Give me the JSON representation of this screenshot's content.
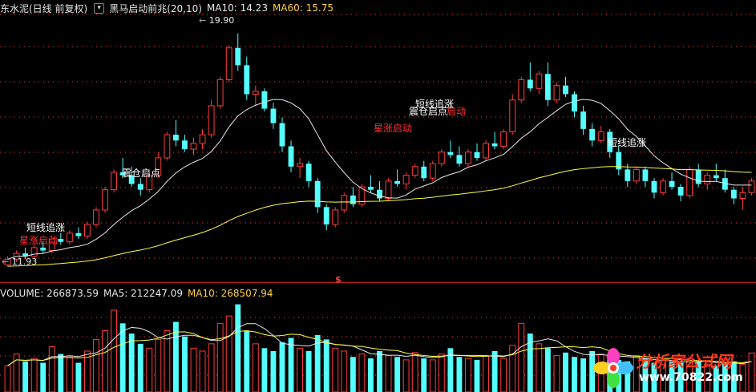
{
  "price_header": {
    "stock_title": "东水泥(日线 前复权)",
    "indicator_name": "黑马启动前兆(20,10)",
    "ma10_label": "MA10: 14.23",
    "ma60_label": "MA60: 15.75"
  },
  "volume_header": {
    "volume_label": "VOLUME: 266873.59",
    "ma5_label": "MA5: 212247.09",
    "ma10_label": "MA10: 268507.94"
  },
  "price_markers": {
    "high_label": "19.90",
    "low_label": "11.93"
  },
  "annotations": [
    {
      "text": "短线追涨",
      "color": "#ffffff"
    },
    {
      "text": "星涨启动",
      "color": "#ff3030"
    },
    {
      "text": "震仓启点",
      "color": "#ffffff"
    },
    {
      "text": "星涨启动",
      "color": "#ff3030"
    },
    {
      "text": "短线追涨",
      "color": "#ffffff"
    },
    {
      "text": "震仓启点",
      "color": "#ffffff"
    },
    {
      "text": "启动",
      "color": "#ff3030"
    },
    {
      "text": "短线追涨",
      "color": "#ffffff"
    }
  ],
  "separator_marker": "$",
  "watermark": {
    "title": "分析家公式网",
    "url": "www.70822.com"
  },
  "colors": {
    "up": "#ff3c3c",
    "down": "#54ffff",
    "ma10_line": "#e8e8e8",
    "ma60_line": "#ffff40",
    "dotted_guides": "#ff3c3c"
  },
  "chart_data": [
    {
      "type": "candlestick",
      "title": "东水泥(日线 前复权)",
      "candles": [
        [
          11.9,
          12.2,
          11.85,
          12.1
        ],
        [
          12.1,
          12.4,
          12.0,
          12.3
        ],
        [
          12.3,
          12.5,
          12.1,
          12.2
        ],
        [
          12.2,
          12.6,
          12.1,
          12.5
        ],
        [
          12.5,
          12.7,
          12.3,
          12.4
        ],
        [
          12.4,
          12.9,
          12.3,
          12.8
        ],
        [
          12.8,
          13.0,
          12.6,
          12.7
        ],
        [
          12.7,
          13.1,
          12.6,
          13.0
        ],
        [
          13.0,
          13.2,
          12.8,
          12.9
        ],
        [
          12.9,
          13.4,
          12.8,
          13.3
        ],
        [
          13.3,
          13.9,
          13.2,
          13.8
        ],
        [
          13.8,
          14.6,
          13.7,
          14.5
        ],
        [
          14.5,
          15.2,
          14.4,
          15.1
        ],
        [
          15.1,
          15.6,
          14.9,
          15.0
        ],
        [
          15.0,
          15.3,
          14.6,
          14.7
        ],
        [
          14.7,
          14.9,
          14.3,
          14.5
        ],
        [
          14.5,
          15.1,
          14.4,
          15.0
        ],
        [
          15.0,
          15.8,
          14.9,
          15.6
        ],
        [
          15.6,
          16.5,
          15.5,
          16.4
        ],
        [
          16.4,
          16.9,
          16.0,
          16.2
        ],
        [
          16.2,
          16.4,
          15.8,
          15.9
        ],
        [
          15.9,
          16.3,
          15.7,
          16.1
        ],
        [
          16.1,
          16.6,
          15.9,
          16.4
        ],
        [
          16.4,
          17.6,
          16.3,
          17.4
        ],
        [
          17.4,
          18.4,
          17.3,
          18.3
        ],
        [
          18.3,
          19.5,
          18.2,
          19.4
        ],
        [
          19.4,
          19.9,
          18.6,
          18.8
        ],
        [
          18.8,
          19.1,
          17.6,
          17.8
        ],
        [
          17.8,
          18.1,
          17.4,
          17.9
        ],
        [
          17.9,
          18.0,
          17.2,
          17.3
        ],
        [
          17.3,
          17.5,
          16.6,
          16.8
        ],
        [
          16.8,
          17.0,
          15.8,
          16.0
        ],
        [
          16.0,
          16.2,
          15.1,
          15.3
        ],
        [
          15.3,
          15.6,
          14.9,
          15.4
        ],
        [
          15.4,
          15.5,
          14.6,
          14.8
        ],
        [
          14.8,
          14.9,
          13.7,
          13.9
        ],
        [
          13.9,
          14.0,
          13.1,
          13.3
        ],
        [
          13.3,
          13.9,
          13.2,
          13.8
        ],
        [
          13.8,
          14.4,
          13.7,
          14.3
        ],
        [
          14.3,
          14.6,
          13.9,
          14.0
        ],
        [
          14.0,
          14.7,
          13.9,
          14.6
        ],
        [
          14.6,
          15.0,
          14.4,
          14.5
        ],
        [
          14.5,
          14.8,
          14.1,
          14.2
        ],
        [
          14.2,
          14.9,
          14.1,
          14.8
        ],
        [
          14.8,
          15.2,
          14.6,
          14.7
        ],
        [
          14.7,
          15.1,
          14.5,
          15.0
        ],
        [
          15.0,
          15.4,
          14.9,
          15.3
        ],
        [
          15.3,
          15.5,
          14.8,
          14.9
        ],
        [
          14.9,
          15.5,
          14.8,
          15.4
        ],
        [
          15.4,
          15.9,
          15.3,
          15.8
        ],
        [
          15.8,
          16.2,
          15.6,
          15.7
        ],
        [
          15.7,
          16.0,
          15.3,
          15.4
        ],
        [
          15.4,
          15.9,
          15.3,
          15.8
        ],
        [
          15.8,
          16.1,
          15.5,
          15.6
        ],
        [
          15.6,
          16.2,
          15.5,
          16.1
        ],
        [
          16.1,
          16.5,
          15.9,
          16.0
        ],
        [
          16.0,
          16.6,
          15.9,
          16.5
        ],
        [
          16.5,
          17.8,
          16.4,
          17.6
        ],
        [
          17.6,
          18.4,
          17.5,
          18.3
        ],
        [
          18.3,
          18.9,
          17.9,
          18.0
        ],
        [
          18.0,
          18.6,
          17.8,
          18.5
        ],
        [
          18.5,
          18.9,
          17.4,
          17.6
        ],
        [
          17.6,
          18.2,
          17.5,
          18.1
        ],
        [
          18.1,
          18.4,
          17.7,
          17.8
        ],
        [
          17.8,
          17.9,
          17.0,
          17.2
        ],
        [
          17.2,
          17.4,
          16.4,
          16.6
        ],
        [
          16.6,
          16.8,
          16.0,
          16.2
        ],
        [
          16.2,
          16.7,
          16.1,
          16.5
        ],
        [
          16.5,
          16.6,
          15.6,
          15.8
        ],
        [
          15.8,
          16.0,
          15.0,
          15.2
        ],
        [
          15.2,
          15.4,
          14.6,
          14.8
        ],
        [
          14.8,
          15.3,
          14.7,
          15.2
        ],
        [
          15.2,
          15.3,
          14.6,
          14.8
        ],
        [
          14.8,
          14.9,
          14.2,
          14.4
        ],
        [
          14.4,
          14.9,
          14.3,
          14.8
        ],
        [
          14.8,
          15.1,
          14.5,
          14.6
        ],
        [
          14.6,
          14.7,
          14.1,
          14.3
        ],
        [
          14.3,
          15.3,
          14.2,
          15.2
        ],
        [
          15.2,
          15.4,
          14.6,
          14.7
        ],
        [
          14.7,
          15.1,
          14.5,
          15.0
        ],
        [
          15.0,
          15.4,
          14.8,
          14.9
        ],
        [
          14.9,
          15.2,
          14.4,
          14.5
        ],
        [
          14.5,
          14.6,
          14.0,
          14.2
        ],
        [
          14.2,
          14.6,
          13.8,
          14.4
        ],
        [
          14.4,
          14.9,
          14.3,
          14.8
        ]
      ],
      "ma10_label": "MA10: 14.23",
      "ma60_label": "MA60: 15.75",
      "ylim": [
        11.5,
        20.5
      ],
      "grid": "dotted-horizontal"
    },
    {
      "type": "bar",
      "title": "VOLUME: 266873.59",
      "series_labels": [
        "MA5: 212247.09",
        "MA10: 268507.94"
      ],
      "values": [
        180,
        260,
        210,
        230,
        200,
        310,
        260,
        240,
        200,
        280,
        360,
        420,
        560,
        470,
        400,
        330,
        300,
        360,
        420,
        480,
        380,
        300,
        280,
        330,
        470,
        520,
        600,
        420,
        330,
        300,
        280,
        340,
        370,
        300,
        280,
        390,
        360,
        300,
        280,
        240,
        260,
        230,
        280,
        250,
        240,
        220,
        270,
        230,
        220,
        260,
        300,
        240,
        230,
        220,
        250,
        280,
        230,
        320,
        470,
        400,
        330,
        300,
        250,
        270,
        240,
        230,
        280,
        260,
        240,
        220,
        210,
        250,
        230,
        200,
        190,
        210,
        200,
        230,
        210,
        190,
        180,
        200,
        210,
        190,
        267
      ],
      "ylim": [
        0,
        620
      ]
    }
  ]
}
